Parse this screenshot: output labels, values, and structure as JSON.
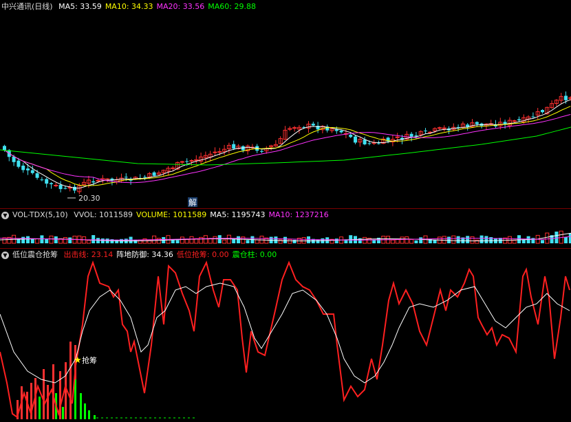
{
  "price_panel": {
    "title": "中兴通讯(日线)",
    "ma": [
      {
        "label": "MA5: 33.59",
        "color": "#ffffff"
      },
      {
        "label": "MA10: 34.33",
        "color": "#ffff00"
      },
      {
        "label": "MA20: 33.56",
        "color": "#ff33ff"
      },
      {
        "label": "MA60: 29.88",
        "color": "#00ff00"
      }
    ],
    "low_label": "20.30",
    "marker_label": "解"
  },
  "volume_panel": {
    "title": "VOL-TDX(5,10)",
    "items": [
      {
        "label": "VVOL: 1011589",
        "color": "#dddddd"
      },
      {
        "label": "VOLUME: 1011589",
        "color": "#ffff00"
      },
      {
        "label": "MA5: 1195743",
        "color": "#ffffff"
      },
      {
        "label": "MA10: 1237216",
        "color": "#ff33ff"
      }
    ]
  },
  "indicator_panel": {
    "title": "低位震仓抢筹",
    "items": [
      {
        "label": "出击线: 23.14",
        "color": "#ff2020"
      },
      {
        "label": "阵地防御: 34.36",
        "color": "#ffffff"
      },
      {
        "label": "低位抢筹: 0.00",
        "color": "#ff2020"
      },
      {
        "label": "震仓柱: 0.00",
        "color": "#00ff00"
      }
    ],
    "signal_label": "抢筹"
  },
  "colors": {
    "up": "#ff3030",
    "down": "#40e0f0",
    "ma5": "#ffffff",
    "ma10": "#ffff00",
    "ma20": "#ff33ff",
    "ma60": "#00ff00",
    "separator": "#7a0000"
  },
  "icons": {
    "collapse": "chevron-down-icon",
    "signal": "star-icon"
  }
}
